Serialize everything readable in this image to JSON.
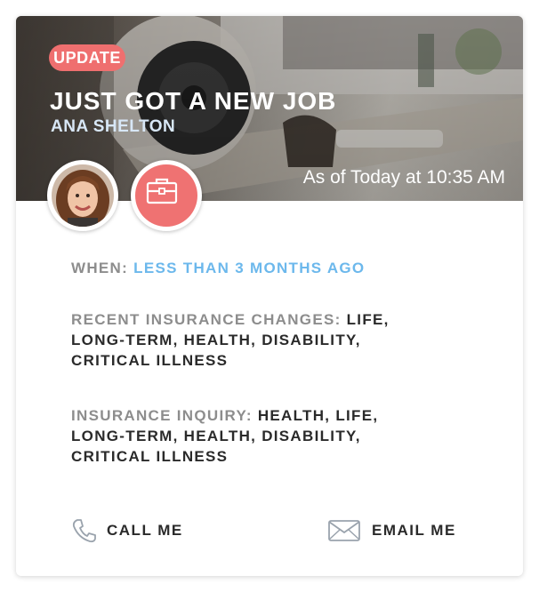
{
  "badge": "UPDATE",
  "title": "JUST GOT A NEW JOB",
  "name": "ANA SHELTON",
  "timestamp": "As of Today at 10:35 AM",
  "job_icon": "briefcase-icon",
  "when": {
    "label": "WHEN:",
    "value": "LESS THAN 3 MONTHS AGO"
  },
  "changes": {
    "label": "RECENT INSURANCE CHANGES:",
    "value": "LIFE, LONG-TERM, HEALTH, DISABILITY, CRITICAL ILLNESS"
  },
  "inquiry": {
    "label": "INSURANCE INQUIRY:",
    "value": "HEALTH, LIFE, LONG-TERM, HEALTH, DISABILITY, CRITICAL ILLNESS"
  },
  "actions": {
    "call": {
      "label": "CALL ME",
      "icon": "phone-icon"
    },
    "email": {
      "label": "EMAIL ME",
      "icon": "envelope-icon"
    }
  },
  "colors": {
    "accent": "#ef6f6f",
    "link": "#6cb8ec",
    "label": "#8d8d8d"
  }
}
